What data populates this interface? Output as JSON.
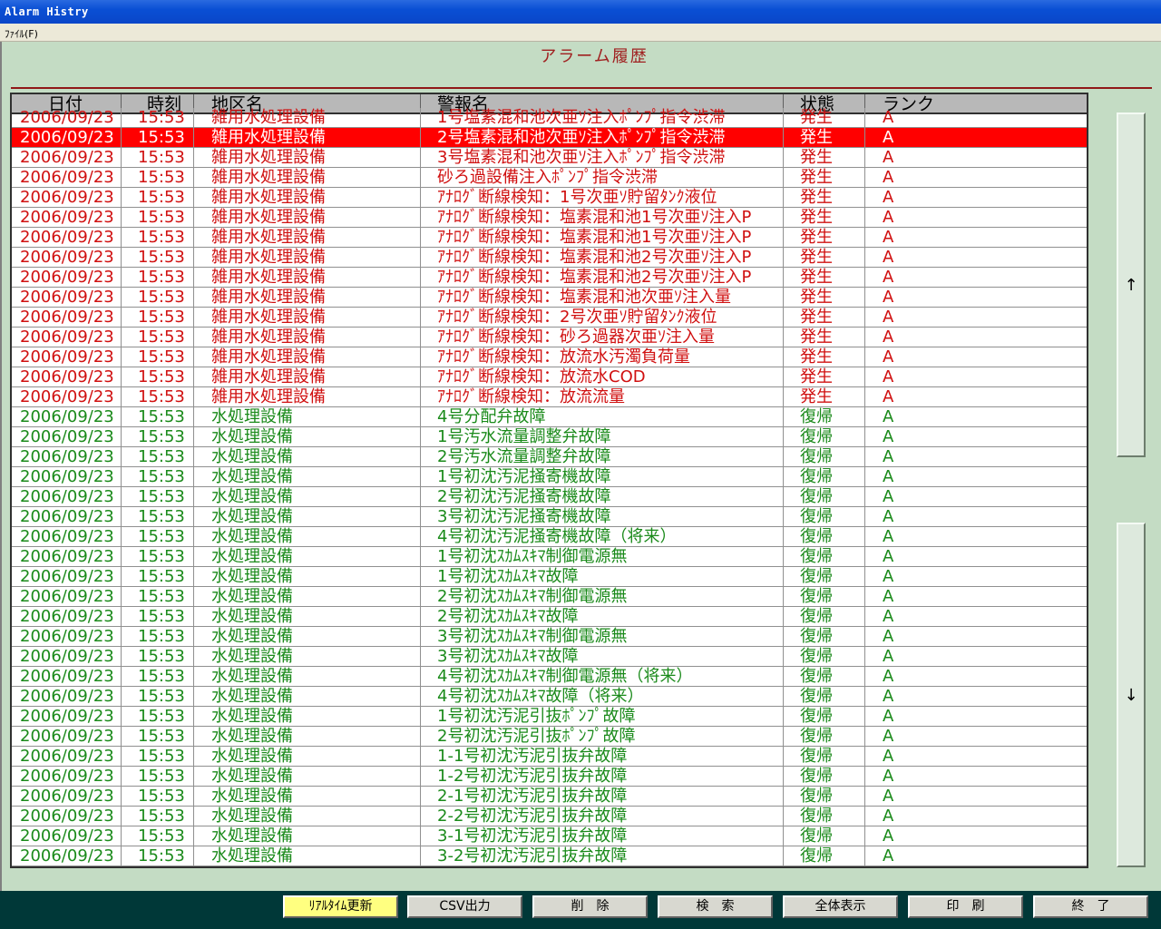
{
  "window": {
    "title": "Alarm Histry"
  },
  "menu": {
    "file": "ﾌｧｲﾙ(F)"
  },
  "page": {
    "title": "アラーム履歴"
  },
  "table": {
    "columns": [
      "日付",
      "時刻",
      "地区名",
      "警報名",
      "状態",
      "ランク"
    ],
    "rows": [
      {
        "date": "2006/09/23",
        "time": "15:53",
        "area": "雑用水処理設備",
        "msg": "1号塩素混和池次亜ｿ注入ﾎﾟﾝﾌﾟ指令渋滞",
        "state": "発生",
        "rank": "A",
        "color": "red"
      },
      {
        "date": "2006/09/23",
        "time": "15:53",
        "area": "雑用水処理設備",
        "msg": "2号塩素混和池次亜ｿ注入ﾎﾟﾝﾌﾟ指令渋滞",
        "state": "発生",
        "rank": "A",
        "color": "sel"
      },
      {
        "date": "2006/09/23",
        "time": "15:53",
        "area": "雑用水処理設備",
        "msg": "3号塩素混和池次亜ｿ注入ﾎﾟﾝﾌﾟ指令渋滞",
        "state": "発生",
        "rank": "A",
        "color": "red"
      },
      {
        "date": "2006/09/23",
        "time": "15:53",
        "area": "雑用水処理設備",
        "msg": "砂ろ過設備注入ﾎﾟﾝﾌﾟ指令渋滞",
        "state": "発生",
        "rank": "A",
        "color": "red"
      },
      {
        "date": "2006/09/23",
        "time": "15:53",
        "area": "雑用水処理設備",
        "msg": "ｱﾅﾛｸﾞ断線検知：1号次亜ｿ貯留ﾀﾝｸ液位",
        "state": "発生",
        "rank": "A",
        "color": "red"
      },
      {
        "date": "2006/09/23",
        "time": "15:53",
        "area": "雑用水処理設備",
        "msg": "ｱﾅﾛｸﾞ断線検知：塩素混和池1号次亜ｿ注入P",
        "state": "発生",
        "rank": "A",
        "color": "red"
      },
      {
        "date": "2006/09/23",
        "time": "15:53",
        "area": "雑用水処理設備",
        "msg": "ｱﾅﾛｸﾞ断線検知：塩素混和池1号次亜ｿ注入P",
        "state": "発生",
        "rank": "A",
        "color": "red"
      },
      {
        "date": "2006/09/23",
        "time": "15:53",
        "area": "雑用水処理設備",
        "msg": "ｱﾅﾛｸﾞ断線検知：塩素混和池2号次亜ｿ注入P",
        "state": "発生",
        "rank": "A",
        "color": "red"
      },
      {
        "date": "2006/09/23",
        "time": "15:53",
        "area": "雑用水処理設備",
        "msg": "ｱﾅﾛｸﾞ断線検知：塩素混和池2号次亜ｿ注入P",
        "state": "発生",
        "rank": "A",
        "color": "red"
      },
      {
        "date": "2006/09/23",
        "time": "15:53",
        "area": "雑用水処理設備",
        "msg": "ｱﾅﾛｸﾞ断線検知：塩素混和池次亜ｿ注入量",
        "state": "発生",
        "rank": "A",
        "color": "red"
      },
      {
        "date": "2006/09/23",
        "time": "15:53",
        "area": "雑用水処理設備",
        "msg": "ｱﾅﾛｸﾞ断線検知：2号次亜ｿ貯留ﾀﾝｸ液位",
        "state": "発生",
        "rank": "A",
        "color": "red"
      },
      {
        "date": "2006/09/23",
        "time": "15:53",
        "area": "雑用水処理設備",
        "msg": "ｱﾅﾛｸﾞ断線検知：砂ろ過器次亜ｿ注入量",
        "state": "発生",
        "rank": "A",
        "color": "red"
      },
      {
        "date": "2006/09/23",
        "time": "15:53",
        "area": "雑用水処理設備",
        "msg": "ｱﾅﾛｸﾞ断線検知：放流水汚濁負荷量",
        "state": "発生",
        "rank": "A",
        "color": "red"
      },
      {
        "date": "2006/09/23",
        "time": "15:53",
        "area": "雑用水処理設備",
        "msg": "ｱﾅﾛｸﾞ断線検知：放流水COD",
        "state": "発生",
        "rank": "A",
        "color": "red"
      },
      {
        "date": "2006/09/23",
        "time": "15:53",
        "area": "雑用水処理設備",
        "msg": "ｱﾅﾛｸﾞ断線検知：放流流量",
        "state": "発生",
        "rank": "A",
        "color": "red"
      },
      {
        "date": "2006/09/23",
        "time": "15:53",
        "area": "水処理設備",
        "msg": "4号分配弁故障",
        "state": "復帰",
        "rank": "A",
        "color": "green"
      },
      {
        "date": "2006/09/23",
        "time": "15:53",
        "area": "水処理設備",
        "msg": "1号汚水流量調整弁故障",
        "state": "復帰",
        "rank": "A",
        "color": "green"
      },
      {
        "date": "2006/09/23",
        "time": "15:53",
        "area": "水処理設備",
        "msg": "2号汚水流量調整弁故障",
        "state": "復帰",
        "rank": "A",
        "color": "green"
      },
      {
        "date": "2006/09/23",
        "time": "15:53",
        "area": "水処理設備",
        "msg": "1号初沈汚泥掻寄機故障",
        "state": "復帰",
        "rank": "A",
        "color": "green"
      },
      {
        "date": "2006/09/23",
        "time": "15:53",
        "area": "水処理設備",
        "msg": "2号初沈汚泥掻寄機故障",
        "state": "復帰",
        "rank": "A",
        "color": "green"
      },
      {
        "date": "2006/09/23",
        "time": "15:53",
        "area": "水処理設備",
        "msg": "3号初沈汚泥掻寄機故障",
        "state": "復帰",
        "rank": "A",
        "color": "green"
      },
      {
        "date": "2006/09/23",
        "time": "15:53",
        "area": "水処理設備",
        "msg": "4号初沈汚泥掻寄機故障（将来）",
        "state": "復帰",
        "rank": "A",
        "color": "green"
      },
      {
        "date": "2006/09/23",
        "time": "15:53",
        "area": "水処理設備",
        "msg": "1号初沈ｽｶﾑｽｷﾏ制御電源無",
        "state": "復帰",
        "rank": "A",
        "color": "green"
      },
      {
        "date": "2006/09/23",
        "time": "15:53",
        "area": "水処理設備",
        "msg": "1号初沈ｽｶﾑｽｷﾏ故障",
        "state": "復帰",
        "rank": "A",
        "color": "green"
      },
      {
        "date": "2006/09/23",
        "time": "15:53",
        "area": "水処理設備",
        "msg": "2号初沈ｽｶﾑｽｷﾏ制御電源無",
        "state": "復帰",
        "rank": "A",
        "color": "green"
      },
      {
        "date": "2006/09/23",
        "time": "15:53",
        "area": "水処理設備",
        "msg": "2号初沈ｽｶﾑｽｷﾏ故障",
        "state": "復帰",
        "rank": "A",
        "color": "green"
      },
      {
        "date": "2006/09/23",
        "time": "15:53",
        "area": "水処理設備",
        "msg": "3号初沈ｽｶﾑｽｷﾏ制御電源無",
        "state": "復帰",
        "rank": "A",
        "color": "green"
      },
      {
        "date": "2006/09/23",
        "time": "15:53",
        "area": "水処理設備",
        "msg": "3号初沈ｽｶﾑｽｷﾏ故障",
        "state": "復帰",
        "rank": "A",
        "color": "green"
      },
      {
        "date": "2006/09/23",
        "time": "15:53",
        "area": "水処理設備",
        "msg": "4号初沈ｽｶﾑｽｷﾏ制御電源無（将来）",
        "state": "復帰",
        "rank": "A",
        "color": "green"
      },
      {
        "date": "2006/09/23",
        "time": "15:53",
        "area": "水処理設備",
        "msg": "4号初沈ｽｶﾑｽｷﾏ故障（将来）",
        "state": "復帰",
        "rank": "A",
        "color": "green"
      },
      {
        "date": "2006/09/23",
        "time": "15:53",
        "area": "水処理設備",
        "msg": "1号初沈汚泥引抜ﾎﾟﾝﾌﾟ故障",
        "state": "復帰",
        "rank": "A",
        "color": "green"
      },
      {
        "date": "2006/09/23",
        "time": "15:53",
        "area": "水処理設備",
        "msg": "2号初沈汚泥引抜ﾎﾟﾝﾌﾟ故障",
        "state": "復帰",
        "rank": "A",
        "color": "green"
      },
      {
        "date": "2006/09/23",
        "time": "15:53",
        "area": "水処理設備",
        "msg": "1-1号初沈汚泥引抜弁故障",
        "state": "復帰",
        "rank": "A",
        "color": "green"
      },
      {
        "date": "2006/09/23",
        "time": "15:53",
        "area": "水処理設備",
        "msg": "1-2号初沈汚泥引抜弁故障",
        "state": "復帰",
        "rank": "A",
        "color": "green"
      },
      {
        "date": "2006/09/23",
        "time": "15:53",
        "area": "水処理設備",
        "msg": "2-1号初沈汚泥引抜弁故障",
        "state": "復帰",
        "rank": "A",
        "color": "green"
      },
      {
        "date": "2006/09/23",
        "time": "15:53",
        "area": "水処理設備",
        "msg": "2-2号初沈汚泥引抜弁故障",
        "state": "復帰",
        "rank": "A",
        "color": "green"
      },
      {
        "date": "2006/09/23",
        "time": "15:53",
        "area": "水処理設備",
        "msg": "3-1号初沈汚泥引抜弁故障",
        "state": "復帰",
        "rank": "A",
        "color": "green"
      },
      {
        "date": "2006/09/23",
        "time": "15:53",
        "area": "水処理設備",
        "msg": "3-2号初沈汚泥引抜弁故障",
        "state": "復帰",
        "rank": "A",
        "color": "green"
      }
    ]
  },
  "scroll": {
    "up": "↑",
    "down": "↓"
  },
  "buttons": {
    "realtime": "ﾘｱﾙﾀｲﾑ更新",
    "csv": "CSV出力",
    "delete": "削　除",
    "search": "検　索",
    "show_all": "全体表示",
    "print": "印　刷",
    "exit": "終　了"
  }
}
